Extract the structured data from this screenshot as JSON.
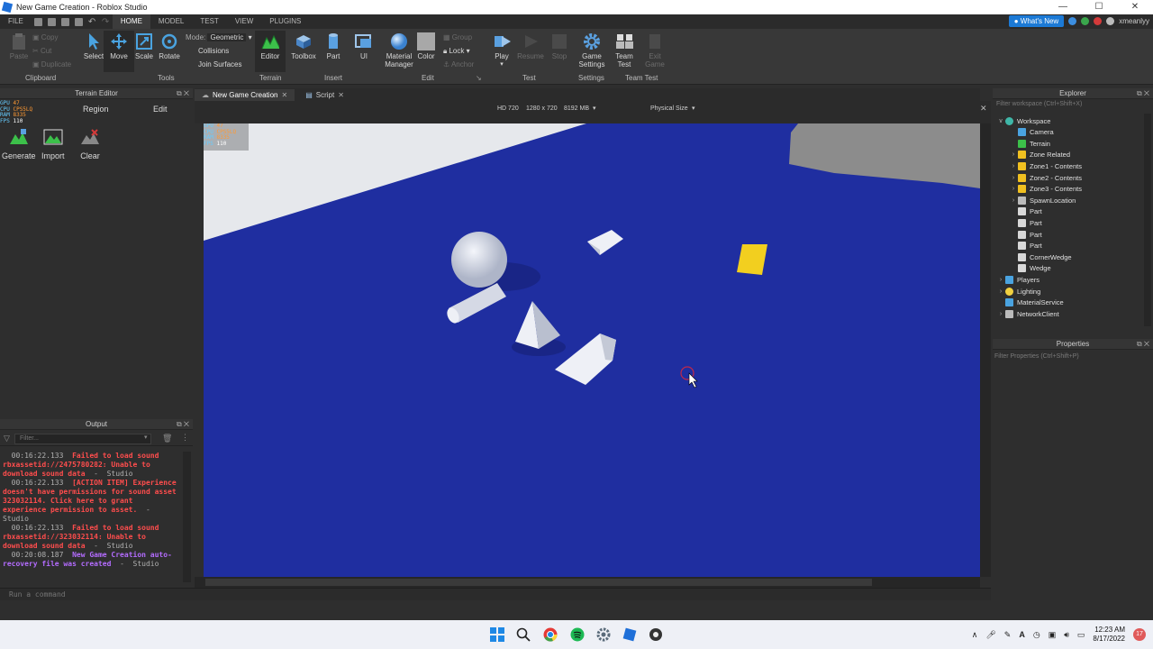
{
  "window": {
    "title": "New Game Creation - Roblox Studio"
  },
  "menu": {
    "file": "FILE",
    "tabs": [
      "HOME",
      "MODEL",
      "TEST",
      "VIEW",
      "PLUGINS"
    ],
    "whats_new": "What's New",
    "user": "xmeanlyy"
  },
  "ribbon": {
    "clipboard": {
      "paste": "Paste",
      "copy": "Copy",
      "cut": "Cut",
      "duplicate": "Duplicate",
      "group": "Clipboard"
    },
    "tools": {
      "select": "Select",
      "move": "Move",
      "scale": "Scale",
      "rotate": "Rotate",
      "group": "Tools",
      "mode_label": "Mode:",
      "mode_value": "Geometric",
      "collisions": "Collisions",
      "join_surfaces": "Join Surfaces"
    },
    "terrain": {
      "editor": "Editor",
      "group": "Terrain"
    },
    "insert": {
      "toolbox": "Toolbox",
      "part": "Part",
      "ui": "UI",
      "group": "Insert"
    },
    "edit": {
      "material_manager": "Material Manager",
      "color": "Color",
      "group_btn": "Group",
      "lock": "Lock",
      "anchor": "Anchor",
      "group": "Edit"
    },
    "test": {
      "play": "Play",
      "resume": "Resume",
      "stop": "Stop",
      "group": "Test"
    },
    "settings": {
      "game_settings": "Game Settings",
      "group": "Settings"
    },
    "team_test": {
      "team_test": "Team Test",
      "exit_game": "Exit Game",
      "group": "Team Test"
    }
  },
  "terrain_editor": {
    "title": "Terrain Editor",
    "tabs": [
      "Region",
      "Edit"
    ],
    "buttons": [
      "Generate",
      "Import",
      "Clear"
    ],
    "stats": {
      "gpu": "47",
      "cpu": "CPS5LQ",
      "ram": "8335",
      "fps": "110"
    }
  },
  "doc_tabs": [
    {
      "label": "New Game Creation"
    },
    {
      "label": "Script"
    }
  ],
  "viewport_bar": {
    "quality": "HD 720",
    "resolution": "1280 x 720",
    "memory": "8192 MB",
    "size_mode": "Physical Size"
  },
  "output": {
    "title": "Output",
    "filter_placeholder": "Filter...",
    "lines": [
      {
        "time": "00:16:22.133",
        "text": "Failed to load sound rbxassetid://2475780282: Unable to download sound data",
        "suffix": "-  Studio",
        "kind": "error"
      },
      {
        "time": "00:16:22.133",
        "text": "[ACTION ITEM] Experience doesn't have permissions for sound asset 323032114. Click here to grant experience permission to asset.",
        "suffix": "-  Studio",
        "kind": "error"
      },
      {
        "time": "00:16:22.133",
        "text": "Failed to load sound rbxassetid://323032114: Unable to download sound data",
        "suffix": "-  Studio",
        "kind": "error"
      },
      {
        "time": "00:20:08.187",
        "text": "New Game Creation auto-recovery file was created",
        "suffix": "-  Studio",
        "kind": "info"
      }
    ]
  },
  "command_bar": {
    "placeholder": "Run a command"
  },
  "explorer": {
    "title": "Explorer",
    "filter_placeholder": "Filter workspace (Ctrl+Shift+X)",
    "items": [
      {
        "label": "Workspace",
        "icon": "globe-icon",
        "color": "#3fb7a8",
        "depth": 0,
        "arrow": "v"
      },
      {
        "label": "Camera",
        "icon": "camera-icon",
        "color": "#4aa3e0",
        "depth": 1,
        "arrow": ""
      },
      {
        "label": "Terrain",
        "icon": "terrain-icon",
        "color": "#3cc04a",
        "depth": 1,
        "arrow": ""
      },
      {
        "label": "Zone Related",
        "icon": "folder-icon",
        "color": "#f0c020",
        "depth": 1,
        "arrow": ">"
      },
      {
        "label": "Zone1 - Contents",
        "icon": "folder-icon",
        "color": "#f0c020",
        "depth": 1,
        "arrow": ">"
      },
      {
        "label": "Zone2 - Contents",
        "icon": "folder-icon",
        "color": "#f0c020",
        "depth": 1,
        "arrow": ">"
      },
      {
        "label": "Zone3 - Contents",
        "icon": "folder-icon",
        "color": "#f0c020",
        "depth": 1,
        "arrow": ">"
      },
      {
        "label": "SpawnLocation",
        "icon": "spawn-icon",
        "color": "#bbbbbb",
        "depth": 1,
        "arrow": ">"
      },
      {
        "label": "Part",
        "icon": "part-icon",
        "color": "#d8d8d8",
        "depth": 1,
        "arrow": ""
      },
      {
        "label": "Part",
        "icon": "part-icon",
        "color": "#d8d8d8",
        "depth": 1,
        "arrow": ""
      },
      {
        "label": "Part",
        "icon": "part-icon",
        "color": "#d8d8d8",
        "depth": 1,
        "arrow": ""
      },
      {
        "label": "Part",
        "icon": "part-icon",
        "color": "#d8d8d8",
        "depth": 1,
        "arrow": ""
      },
      {
        "label": "CornerWedge",
        "icon": "part-icon",
        "color": "#d8d8d8",
        "depth": 1,
        "arrow": ""
      },
      {
        "label": "Wedge",
        "icon": "part-icon",
        "color": "#d8d8d8",
        "depth": 1,
        "arrow": ""
      },
      {
        "label": "Players",
        "icon": "players-icon",
        "color": "#4aa3e0",
        "depth": 0,
        "arrow": ">"
      },
      {
        "label": "Lighting",
        "icon": "bulb-icon",
        "color": "#f0d040",
        "depth": 0,
        "arrow": ">"
      },
      {
        "label": "MaterialService",
        "icon": "material-icon",
        "color": "#4aa3e0",
        "depth": 0,
        "arrow": ""
      },
      {
        "label": "NetworkClient",
        "icon": "network-icon",
        "color": "#bbbbbb",
        "depth": 0,
        "arrow": ">"
      }
    ]
  },
  "properties": {
    "title": "Properties",
    "filter_placeholder": "Filter Properties (Ctrl+Shift+P)"
  },
  "taskbar": {
    "time": "12:23 AM",
    "date": "8/17/2022",
    "notifications": "17"
  },
  "colors": {
    "baseplate": "#1f2ea0",
    "accent": "#1c7ad6",
    "part": "#d9dde8",
    "yellow_block": "#f2cf1f"
  }
}
